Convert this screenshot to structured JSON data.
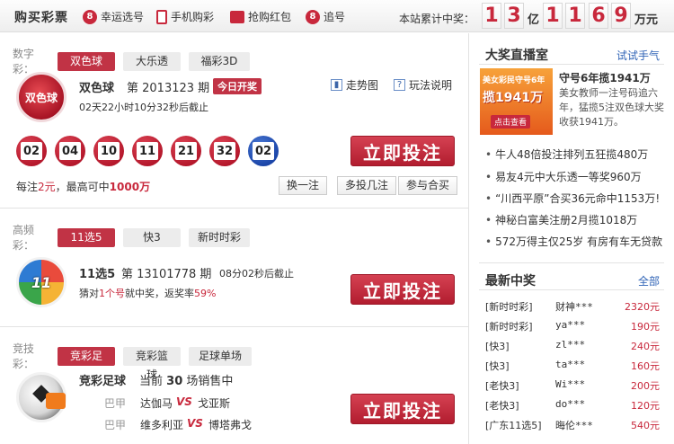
{
  "header": {
    "brand": "购买彩票",
    "nav": [
      {
        "icon": "number-8-icon",
        "glyph": "8",
        "label": "幸运选号"
      },
      {
        "icon": "phone-icon",
        "glyph": "",
        "label": "手机购彩"
      },
      {
        "icon": "red-packet-icon",
        "glyph": "",
        "label": "抢购红包"
      },
      {
        "icon": "number-8-icon",
        "glyph": "8",
        "label": "追号"
      }
    ],
    "jackpot_label": "本站累计中奖：",
    "jackpot_digits": [
      "1",
      "3",
      "1",
      "1",
      "6",
      "9"
    ],
    "unit_yi": "亿",
    "unit_wanyuan": "万元"
  },
  "shuzi": {
    "label": "数字彩：",
    "tabs": [
      "双色球",
      "大乐透",
      "福彩3D"
    ],
    "game": "双色球",
    "issue": "第 2013123 期",
    "today": "今日开奖",
    "countdown": "02天22小时10分32秒后截止",
    "trend": "走势图",
    "help": "玩法说明",
    "balls_red": [
      "02",
      "04",
      "10",
      "11",
      "21",
      "32"
    ],
    "ball_blue": "02",
    "bet": "立即投注",
    "price_pre": "每注",
    "price": "2元",
    "price_mid": "，最高可中",
    "prize": "1000万",
    "opts": [
      "换一注",
      "多投几注",
      "参与合买"
    ],
    "logo_text": "双色球"
  },
  "gaopin": {
    "label": "高频彩：",
    "tabs": [
      "11选5",
      "快3",
      "新时时彩"
    ],
    "game": "11选5",
    "issue": "第 13101778 期",
    "countdown": "08分02秒后截止",
    "desc_pre": "猜对",
    "desc_hl": "1个号",
    "desc_mid": "就中奖，返奖率",
    "rate": "59%",
    "bet": "立即投注",
    "logo_text": "11"
  },
  "jingji": {
    "label": "竞技彩：",
    "tabs": [
      "竞彩足球",
      "竞彩篮球",
      "足球单场"
    ],
    "game": "竞彩足球",
    "desc_pre": "当前",
    "count": "30",
    "desc_post": "场销售中",
    "matches": [
      {
        "league": "巴甲",
        "home": "达伽马",
        "vs": "VS",
        "away": "戈亚斯"
      },
      {
        "league": "巴甲",
        "home": "维多利亚",
        "vs": "VS",
        "away": "博塔弗戈"
      }
    ],
    "bet": "立即投注"
  },
  "live": {
    "title": "大奖直播室",
    "link": "试试手气",
    "banner_line1": "美女彩民守号6年",
    "banner_line2": "揽1941万",
    "banner_btn": "点击查看",
    "headline": "守号6年揽1941万",
    "summary": "美女教师一注号码追六年，猛揽5注双色球大奖收获1941万。",
    "news": [
      "牛人48倍投注排列五狂揽480万",
      "易友4元中大乐透一等奖960万",
      "“川西平原”合买36元命中1153万!",
      "神秘白富美注册2月揽1018万",
      "572万得主仅25岁 有房有车无贷款"
    ]
  },
  "winners": {
    "title": "最新中奖",
    "link": "全部",
    "rows": [
      {
        "game": "[新时时彩]",
        "user": "财神***",
        "amount": "2320元"
      },
      {
        "game": "[新时时彩]",
        "user": "ya***",
        "amount": "190元"
      },
      {
        "game": "[快3]",
        "user": "zl***",
        "amount": "240元"
      },
      {
        "game": "[快3]",
        "user": "ta***",
        "amount": "160元"
      },
      {
        "game": "[老快3]",
        "user": "Wi***",
        "amount": "200元"
      },
      {
        "game": "[老快3]",
        "user": "do***",
        "amount": "120元"
      },
      {
        "game": "[广东11选5]",
        "user": "晦伦***",
        "amount": "540元"
      }
    ]
  }
}
